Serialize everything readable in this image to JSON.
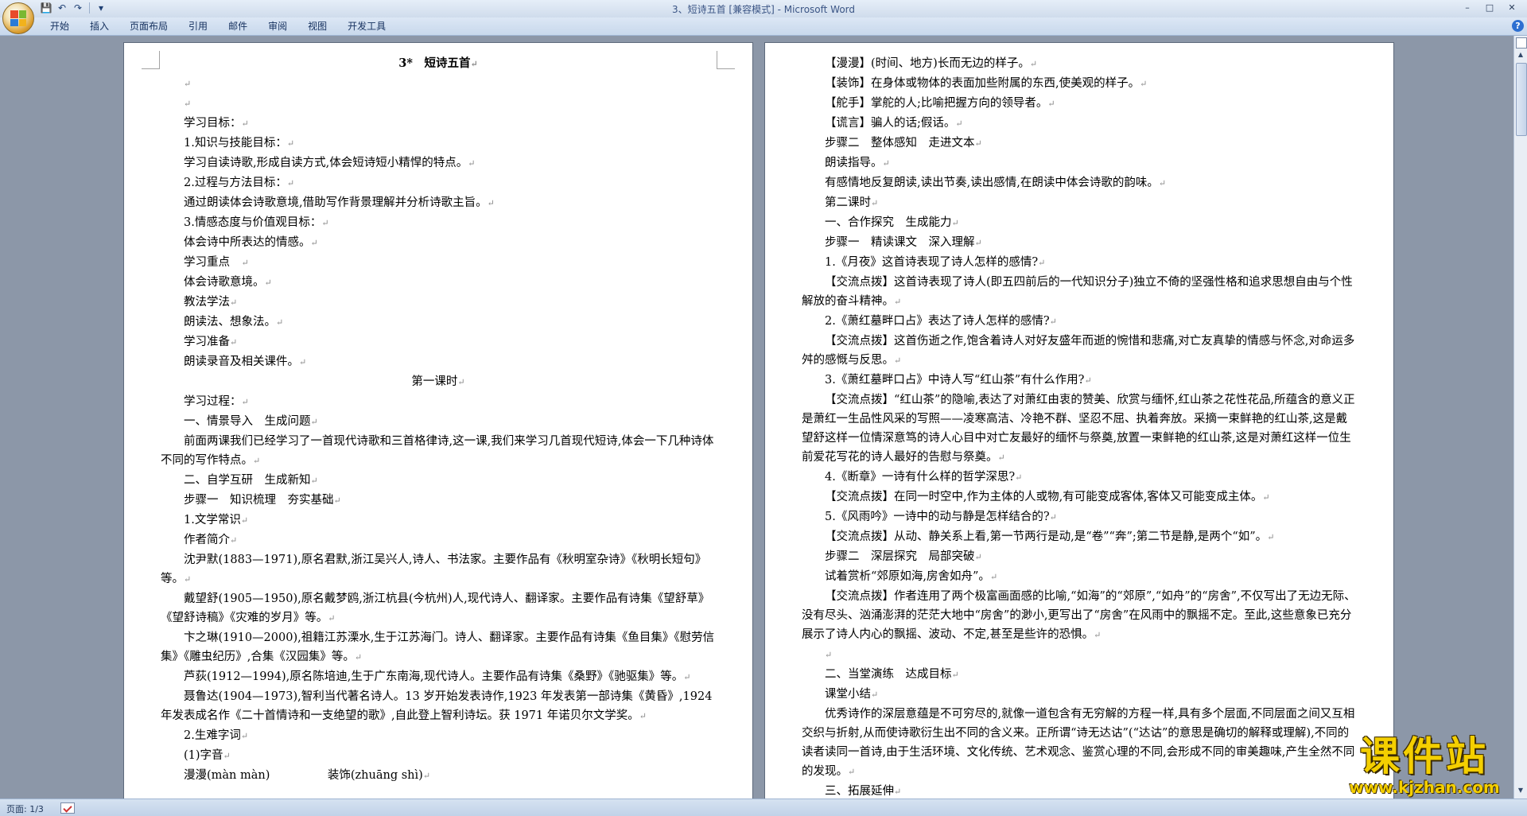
{
  "window": {
    "title": "3、短诗五首 [兼容模式] - Microsoft Word",
    "controls": [
      "–",
      "□",
      "✕"
    ]
  },
  "qat": {
    "save_icon": "save-icon",
    "undo_icon": "undo-icon",
    "redo_icon": "redo-icon",
    "customize_icon": "customize-qat-icon"
  },
  "ribbon": {
    "tabs": [
      "开始",
      "插入",
      "页面布局",
      "引用",
      "邮件",
      "审阅",
      "视图",
      "开发工具"
    ],
    "help": "?"
  },
  "left_page": [
    {
      "text": "3*　短诗五首",
      "style": "title"
    },
    {
      "text": ""
    },
    {
      "text": ""
    },
    {
      "text": "学习目标："
    },
    {
      "text": "1.知识与技能目标："
    },
    {
      "text": "学习自读诗歌,形成自读方式,体会短诗短小精悍的特点。"
    },
    {
      "text": "2.过程与方法目标："
    },
    {
      "text": "通过朗读体会诗歌意境,借助写作背景理解并分析诗歌主旨。"
    },
    {
      "text": "3.情感态度与价值观目标："
    },
    {
      "text": "体会诗中所表达的情感。"
    },
    {
      "text": "学习重点　"
    },
    {
      "text": "体会诗歌意境。"
    },
    {
      "text": "教法学法"
    },
    {
      "text": "朗读法、想象法。"
    },
    {
      "text": "学习准备"
    },
    {
      "text": "朗读录音及相关课件。"
    },
    {
      "text": "第一课时",
      "style": "center"
    },
    {
      "text": "学习过程："
    },
    {
      "text": "一、情景导入　生成问题"
    },
    {
      "text": "前面两课我们已经学习了一首现代诗歌和三首格律诗,这一课,我们来学习几首现代短诗,体会一下几种诗体不同的写作特点。"
    },
    {
      "text": "二、自学互研　生成新知"
    },
    {
      "text": "步骤一　知识梳理　夯实基础"
    },
    {
      "text": "1.文学常识"
    },
    {
      "text": "作者简介"
    },
    {
      "text": "沈尹默(1883—1971),原名君默,浙江吴兴人,诗人、书法家。主要作品有《秋明室杂诗》《秋明长短句》等。"
    },
    {
      "text": "戴望舒(1905—1950),原名戴梦鸥,浙江杭县(今杭州)人,现代诗人、翻译家。主要作品有诗集《望舒草》《望舒诗稿》《灾难的岁月》等。"
    },
    {
      "text": "卞之琳(1910—2000),祖籍江苏溧水,生于江苏海门。诗人、翻译家。主要作品有诗集《鱼目集》《慰劳信集》《雕虫纪历》,合集《汉园集》等。"
    },
    {
      "text": "芦荻(1912—1994),原名陈培迪,生于广东南海,现代诗人。主要作品有诗集《桑野》《驰驱集》等。"
    },
    {
      "text": "聂鲁达(1904—1973),智利当代著名诗人。13 岁开始发表诗作,1923 年发表第一部诗集《黄昏》,1924 年发表成名作《二十首情诗和一支绝望的歌》,自此登上智利诗坛。获 1971 年诺贝尔文学奖。"
    },
    {
      "text": "2.生难字词"
    },
    {
      "text": "(1)字音"
    },
    {
      "text": "漫漫(màn màn)　　　　　装饰(zhuāng shì)"
    }
  ],
  "right_page": [
    {
      "text": "【漫漫】(时间、地方)长而无边的样子。"
    },
    {
      "text": "【装饰】在身体或物体的表面加些附属的东西,使美观的样子。"
    },
    {
      "text": "【舵手】掌舵的人;比喻把握方向的领导者。"
    },
    {
      "text": "【谎言】骗人的话;假话。"
    },
    {
      "text": "步骤二　整体感知　走进文本"
    },
    {
      "text": "朗读指导。"
    },
    {
      "text": "有感情地反复朗读,读出节奏,读出感情,在朗读中体会诗歌的韵味。"
    },
    {
      "text": "第二课时"
    },
    {
      "text": "一、合作探究　生成能力"
    },
    {
      "text": "步骤一　精读课文　深入理解"
    },
    {
      "text": "1.《月夜》这首诗表现了诗人怎样的感情?"
    },
    {
      "text": "【交流点拨】这首诗表现了诗人(即五四前后的一代知识分子)独立不倚的坚强性格和追求思想自由与个性解放的奋斗精神。"
    },
    {
      "text": "2.《萧红墓畔口占》表达了诗人怎样的感情?"
    },
    {
      "text": "【交流点拨】这首伤逝之作,饱含着诗人对好友盛年而逝的惋惜和悲痛,对亡友真挚的情感与怀念,对命运多舛的感慨与反思。"
    },
    {
      "text": "3.《萧红墓畔口占》中诗人写“红山茶”有什么作用?"
    },
    {
      "text": "【交流点拨】“红山茶”的隐喻,表达了对萧红由衷的赞美、欣赏与缅怀,红山茶之花性花品,所蕴含的意义正是萧红一生品性风采的写照——凌寒高洁、冷艳不群、坚忍不屈、执着奔放。采摘一束鲜艳的红山茶,这是戴望舒这样一位情深意笃的诗人心目中对亡友最好的缅怀与祭奠,放置一束鲜艳的红山茶,这是对萧红这样一位生前爱花写花的诗人最好的告慰与祭奠。"
    },
    {
      "text": "4.《断章》一诗有什么样的哲学深思?"
    },
    {
      "text": "【交流点拨】在同一时空中,作为主体的人或物,有可能变成客体,客体又可能变成主体。"
    },
    {
      "text": "5.《风雨吟》一诗中的动与静是怎样结合的?"
    },
    {
      "text": "【交流点拨】从动、静关系上看,第一节两行是动,是“卷”“奔”;第二节是静,是两个“如”。"
    },
    {
      "text": "步骤二　深层探究　局部突破"
    },
    {
      "text": "试着赏析“郊原如海,房舍如舟”。"
    },
    {
      "text": "【交流点拨】作者连用了两个极富画面感的比喻,“如海”的“郊原”,“如舟”的“房舍”,不仅写出了无边无际、没有尽头、汹涌澎湃的茫茫大地中“房舍”的渺小,更写出了“房舍”在风雨中的飘摇不定。至此,这些意象已充分展示了诗人内心的飘摇、波动、不定,甚至是些许的恐惧。"
    },
    {
      "text": ""
    },
    {
      "text": "二、当堂演练　达成目标"
    },
    {
      "text": "课堂小结"
    },
    {
      "text": "优秀诗作的深层意蕴是不可穷尽的,就像一道包含有无穷解的方程一样,具有多个层面,不同层面之间又互相交织与折射,从而使诗歌衍生出不同的含义来。正所谓“诗无达诂”(“达诂”的意思是确切的解释或理解),不同的读者读同一首诗,由于生活环境、文化传统、艺术观念、鉴赏心理的不同,会形成不同的审美趣味,产生全然不同的发现。"
    },
    {
      "text": "三、拓展延伸"
    }
  ],
  "statusbar": {
    "page_info": "页面: 1/3"
  },
  "watermark": {
    "main": "课件站",
    "url": "www.kjzhan.com"
  }
}
